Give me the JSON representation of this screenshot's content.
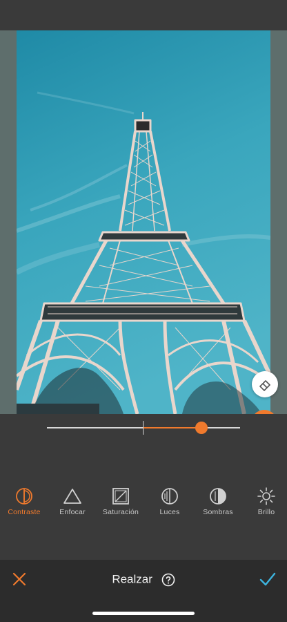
{
  "editor": {
    "title": "Realzar",
    "cancel_icon": "close-icon",
    "confirm_icon": "checkmark-icon",
    "help_icon": "help-circle-icon"
  },
  "photo": {
    "subject": "eiffel-tower-photo",
    "sky_color": "#3aa6bd",
    "tower_color": "#e8d2c8"
  },
  "floating_tools": {
    "eraser_icon": "eraser-icon",
    "compare_icon": "compare-split-icon"
  },
  "slider": {
    "value": 0.6,
    "accent_color": "#f07a2d"
  },
  "tools": [
    {
      "id": "contraste",
      "label": "Contraste",
      "icon": "contrast-icon",
      "active": true
    },
    {
      "id": "enfocar",
      "label": "Enfocar",
      "icon": "triangle-icon",
      "active": false
    },
    {
      "id": "saturacion",
      "label": "Saturación",
      "icon": "saturation-icon",
      "active": false
    },
    {
      "id": "luces",
      "label": "Luces",
      "icon": "highlights-icon",
      "active": false
    },
    {
      "id": "sombras",
      "label": "Sombras",
      "icon": "shadows-icon",
      "active": false
    },
    {
      "id": "brillo",
      "label": "Brillo",
      "icon": "sun-icon",
      "active": false
    }
  ],
  "colors": {
    "accent": "#f07a2d",
    "confirm": "#3db5e0",
    "background": "#3a3a3a",
    "bottom_bar": "#2c2c2c"
  }
}
